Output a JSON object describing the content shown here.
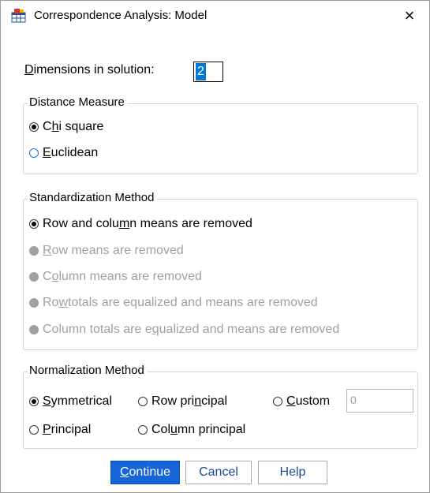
{
  "window": {
    "title": "Correspondence Analysis: Model",
    "close_label": "×"
  },
  "dimensions": {
    "label_pre": "D",
    "label_post": "imensions in solution:",
    "value": "2"
  },
  "distance": {
    "legend": "Distance Measure",
    "chi": {
      "pre": "C",
      "ul": "h",
      "post": "i square"
    },
    "euclid": {
      "pre": "",
      "ul": "E",
      "post": "uclidean"
    }
  },
  "standardization": {
    "legend": "Standardization Method",
    "opt1": {
      "pre": "Row and colu",
      "ul": "m",
      "post": "n means are removed"
    },
    "opt2": {
      "pre": "",
      "ul": "R",
      "post": "ow means are removed"
    },
    "opt3": {
      "pre": "C",
      "ul": "o",
      "post": "lumn means are removed"
    },
    "opt4": {
      "pre": "Ro",
      "ul": "w",
      "post": " totals are equalized and means are removed"
    },
    "opt5": {
      "pre": "Column totals are e",
      "ul": "q",
      "post": "ualized and means are removed"
    }
  },
  "normalization": {
    "legend": "Normalization Method",
    "symmetrical": {
      "pre": "",
      "ul": "S",
      "post": "ymmetrical"
    },
    "row_principal": {
      "pre": "Row pri",
      "ul": "n",
      "post": "cipal"
    },
    "custom": {
      "pre": "",
      "ul": "C",
      "post": "ustom"
    },
    "custom_value": "0",
    "principal": {
      "pre": "",
      "ul": "P",
      "post": "rincipal"
    },
    "column_principal": {
      "pre": "Col",
      "ul": "u",
      "post": "mn principal"
    }
  },
  "buttons": {
    "continue": {
      "pre": "",
      "ul": "C",
      "post": "ontinue"
    },
    "cancel": "Cancel",
    "help": "Help"
  },
  "colors": {
    "accent": "#1565d8",
    "disabled": "#a0a0a0"
  }
}
